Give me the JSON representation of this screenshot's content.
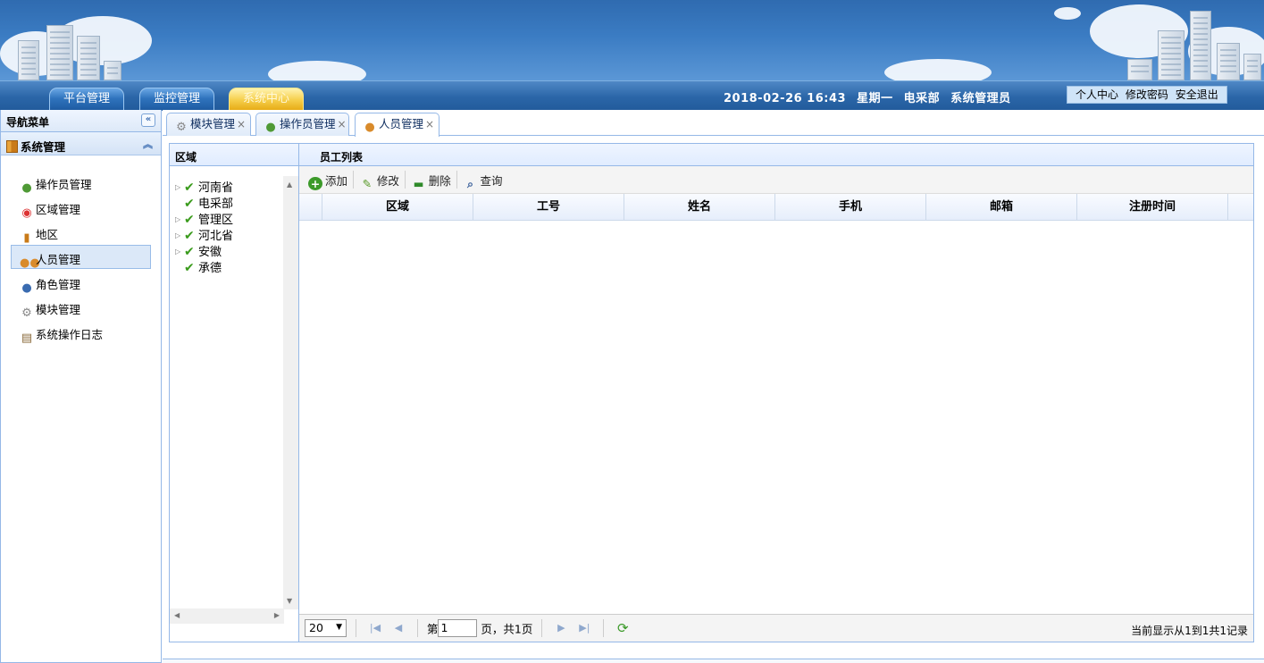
{
  "nav_tabs": [
    {
      "label": "平台管理",
      "active": false
    },
    {
      "label": "监控管理",
      "active": false
    },
    {
      "label": "系统中心",
      "active": true
    }
  ],
  "status": {
    "datetime": "2018-02-26 16:43",
    "weekday": "星期一",
    "department": "电采部",
    "role": "系统管理员"
  },
  "user_links": [
    "个人中心",
    "修改密码",
    "安全退出"
  ],
  "sidebar": {
    "title": "导航菜单",
    "group": "系统管理",
    "items": [
      {
        "label": "操作员管理",
        "icon": "user-icon"
      },
      {
        "label": "区域管理",
        "icon": "map-pin-icon"
      },
      {
        "label": "地区",
        "icon": "book-icon"
      },
      {
        "label": "人员管理",
        "icon": "users-icon",
        "active": true
      },
      {
        "label": "角色管理",
        "icon": "group-icon"
      },
      {
        "label": "模块管理",
        "icon": "gear-icon"
      },
      {
        "label": "系统操作日志",
        "icon": "clipboard-icon"
      }
    ]
  },
  "content_tabs": [
    {
      "label": "模块管理",
      "icon": "gear-icon"
    },
    {
      "label": "操作员管理",
      "icon": "user-icon"
    },
    {
      "label": "人员管理",
      "icon": "users-icon",
      "active": true
    }
  ],
  "region_panel": {
    "title": "区域",
    "tree": [
      {
        "label": "河南省",
        "expandable": true
      },
      {
        "label": "电采部",
        "expandable": false
      },
      {
        "label": "管理区",
        "expandable": true
      },
      {
        "label": "河北省",
        "expandable": true
      },
      {
        "label": "安徽",
        "expandable": true
      },
      {
        "label": "承德",
        "expandable": false
      }
    ]
  },
  "employee_panel": {
    "title": "员工列表",
    "toolbar": {
      "add": "添加",
      "edit": "修改",
      "delete": "删除",
      "query": "查询"
    },
    "columns": [
      "区域",
      "工号",
      "姓名",
      "手机",
      "邮箱",
      "注册时间"
    ],
    "rows": []
  },
  "pager": {
    "page_size": "20",
    "page_prefix": "第",
    "current_page": "1",
    "page_suffix": "页，共1页",
    "info": "当前显示从1到1共1记录"
  },
  "colors": {
    "accent_blue": "#2b66a8",
    "active_tab_gold": "#f6d04e",
    "border": "#95b8e7",
    "check_green": "#3a9b1c"
  }
}
